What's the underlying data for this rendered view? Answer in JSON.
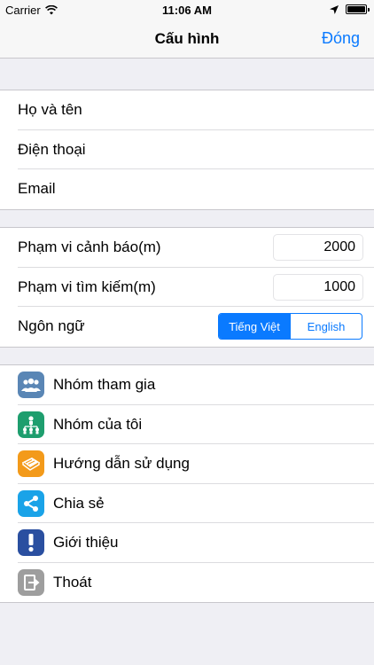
{
  "status": {
    "carrier": "Carrier",
    "time": "11:06 AM"
  },
  "nav": {
    "title": "Cấu hình",
    "done_label": "Đóng"
  },
  "profile": {
    "name_label": "Họ và tên",
    "phone_label": "Điện thoại",
    "email_label": "Email"
  },
  "settings": {
    "alert_range_label": "Phạm vi cảnh báo(m)",
    "alert_range_value": "2000",
    "search_range_label": "Phạm vi tìm kiếm(m)",
    "search_range_value": "1000",
    "language_label": "Ngôn ngữ",
    "language_options": [
      "Tiếng Việt",
      "English"
    ],
    "language_selected": "Tiếng Việt"
  },
  "menu": {
    "items": [
      {
        "label": "Nhóm tham gia",
        "icon": "joined-groups-icon",
        "color": "#5a86b5"
      },
      {
        "label": "Nhóm của tôi",
        "icon": "my-groups-icon",
        "color": "#1e9e6e"
      },
      {
        "label": "Hướng dẫn sử dụng",
        "icon": "guide-book-icon",
        "color": "#f39a1a"
      },
      {
        "label": "Chia sẻ",
        "icon": "share-icon",
        "color": "#1aa3e8"
      },
      {
        "label": "Giới thiệu",
        "icon": "info-icon",
        "color": "#2a4fa0"
      },
      {
        "label": "Thoát",
        "icon": "logout-icon",
        "color": "#9e9e9e"
      }
    ]
  },
  "colors": {
    "accent": "#0a7aff",
    "background": "#efeff4"
  }
}
